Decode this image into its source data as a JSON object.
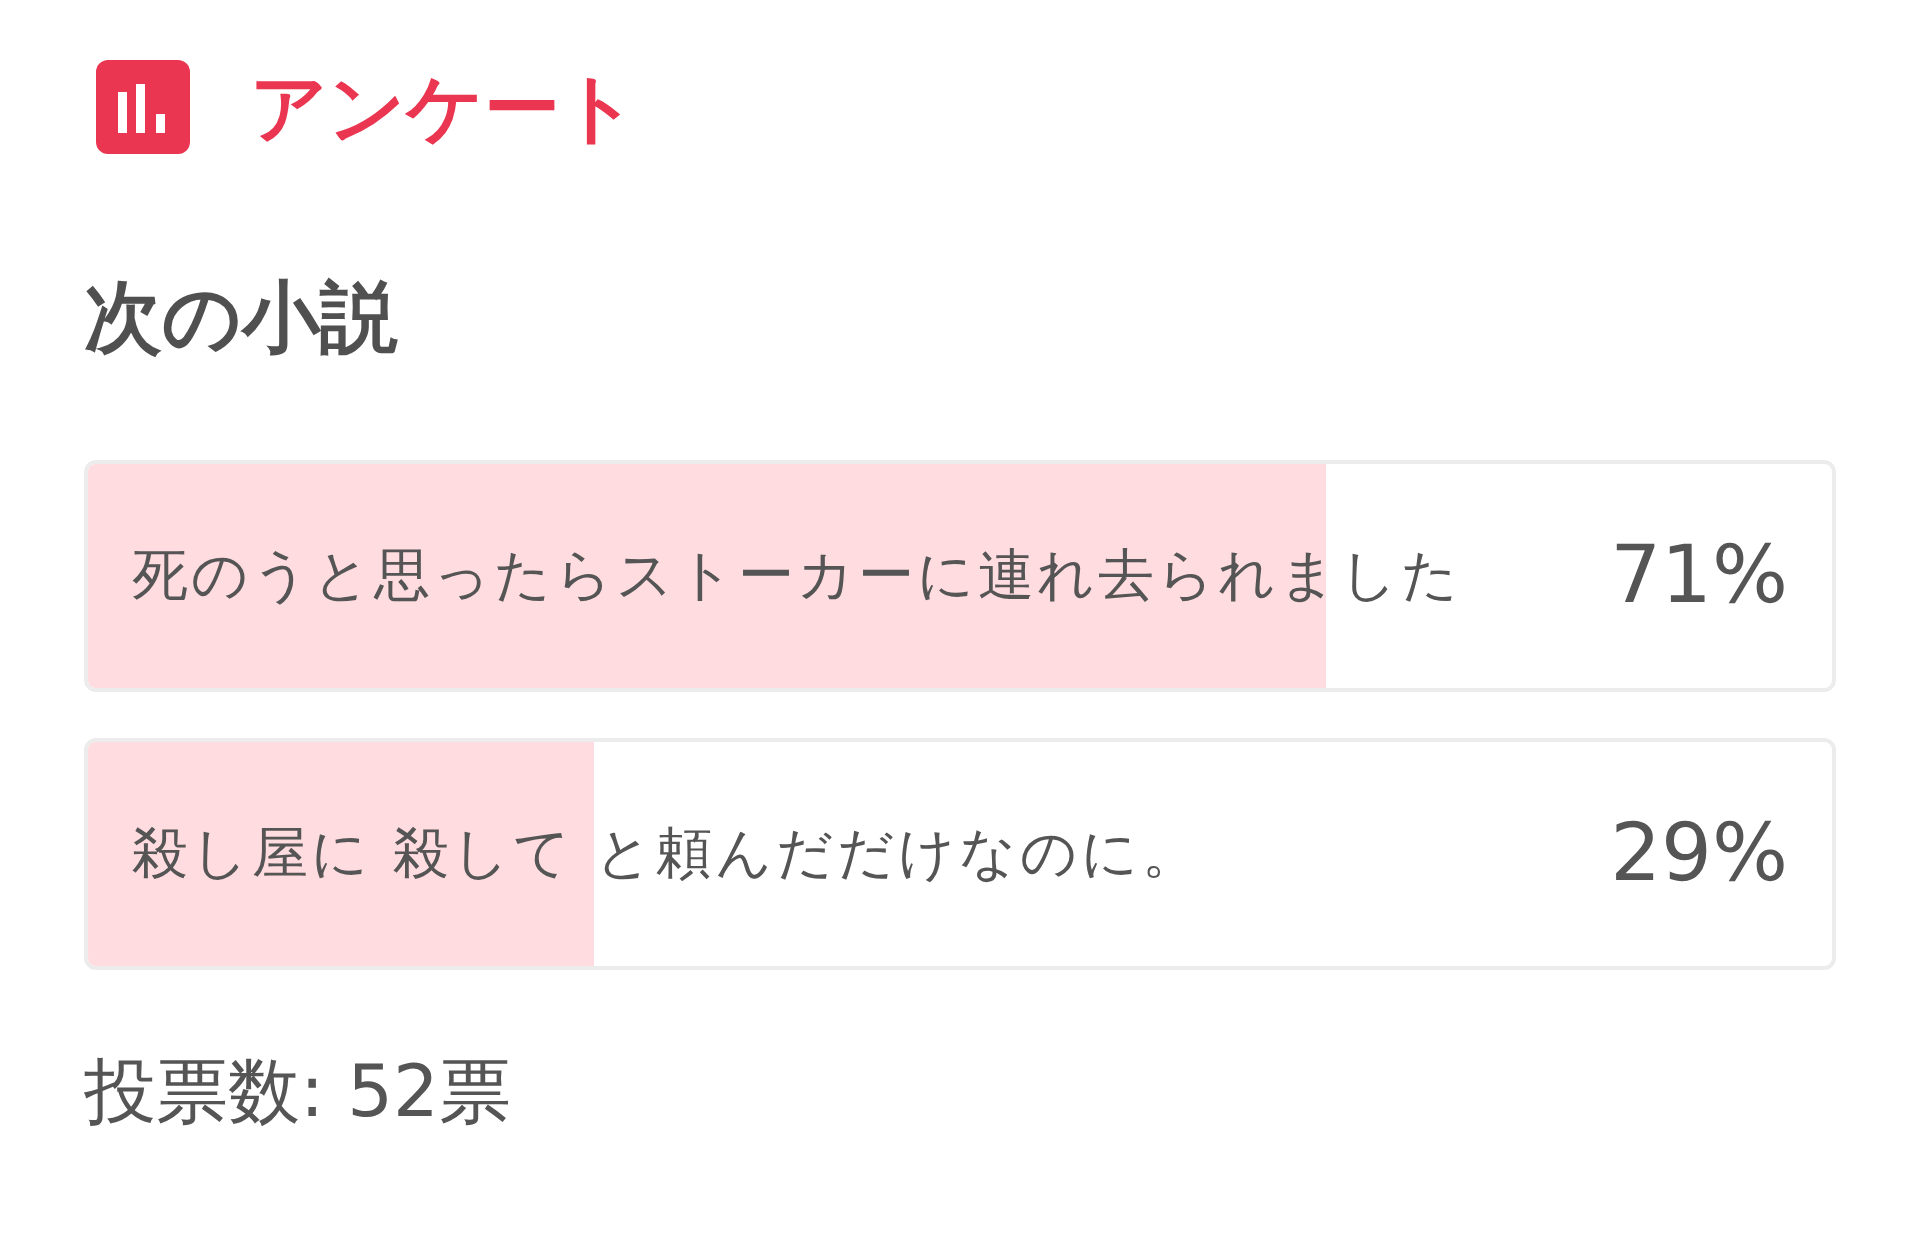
{
  "header": {
    "title": "アンケート"
  },
  "poll": {
    "question": "次の小説",
    "options": [
      {
        "label": "死のうと思ったらストーカーに連れ去られました",
        "level": 0.71,
        "percent": "71%"
      },
      {
        "label": "殺し屋に 殺して と頼んだだけなのに。",
        "level": 0.29,
        "percent": "29%"
      }
    ],
    "total_votes": "投票数: 52票"
  }
}
